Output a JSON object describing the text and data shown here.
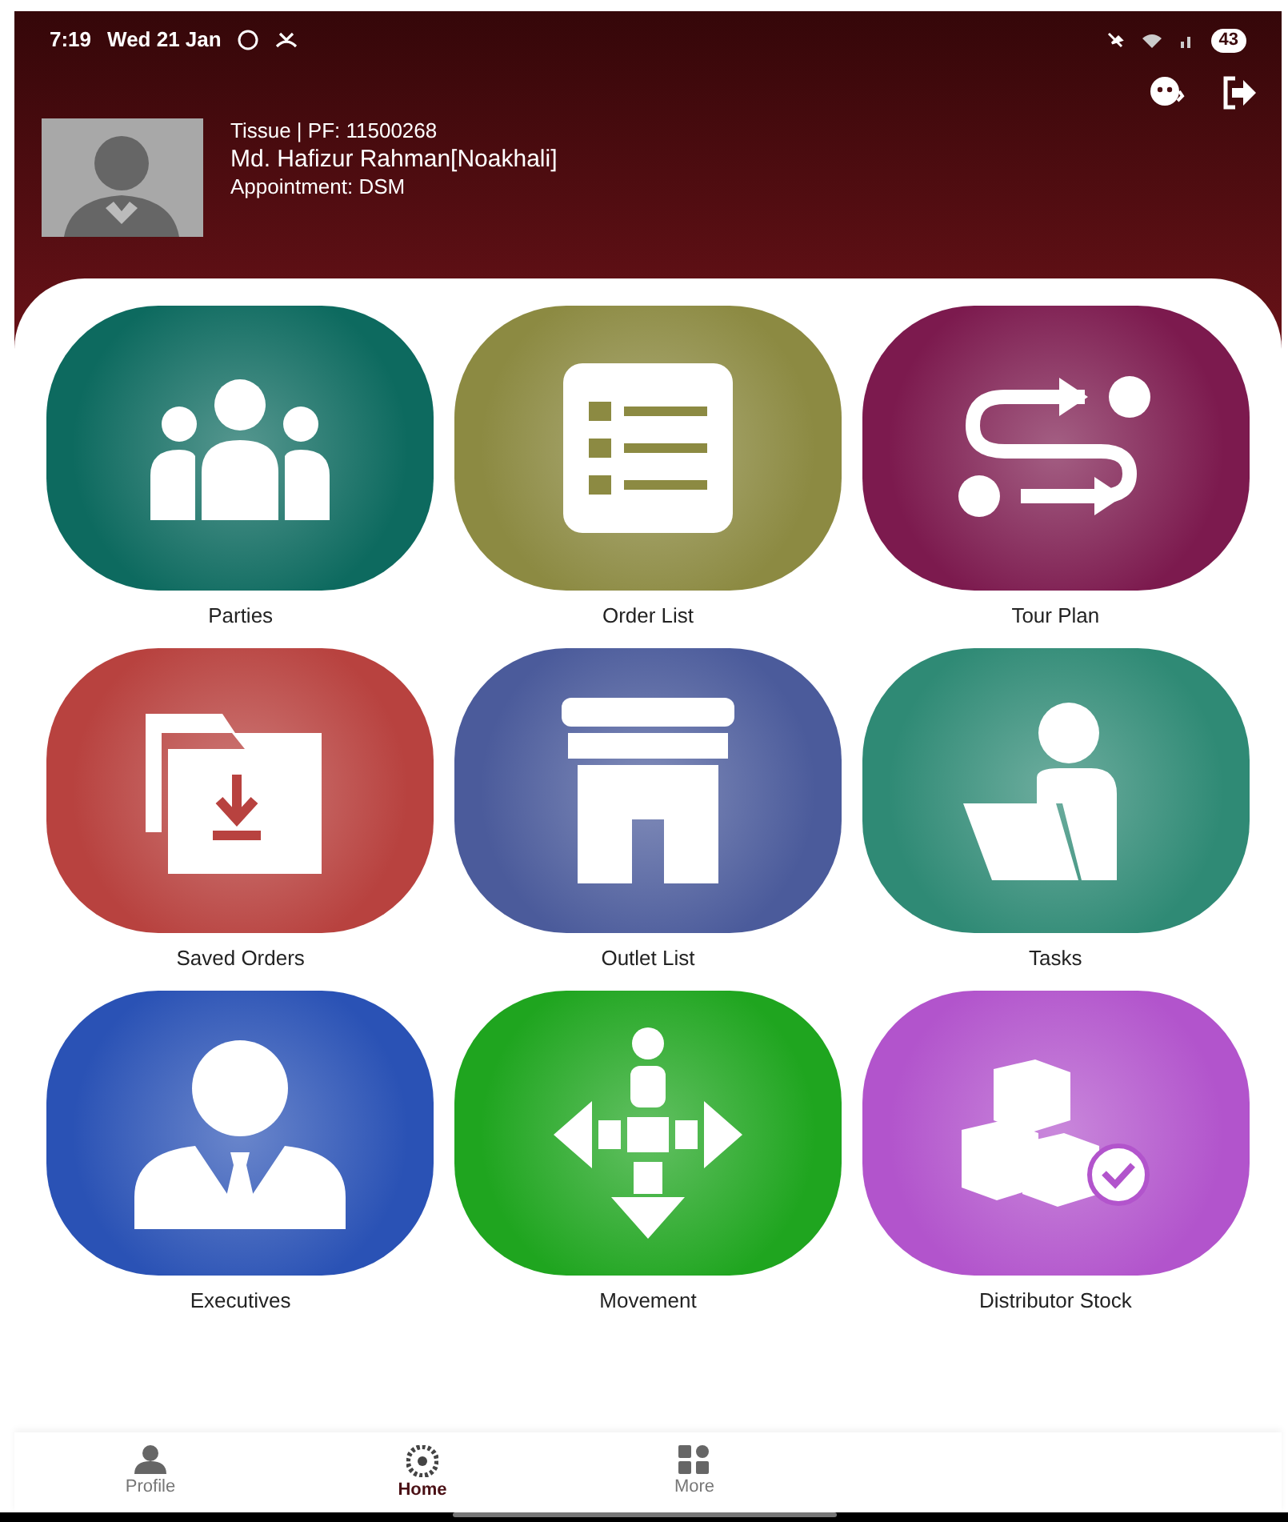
{
  "status_bar": {
    "time": "7:19",
    "date": "Wed 21 Jan",
    "battery": "43"
  },
  "profile": {
    "line_1": "Tissue | PF: 11500268",
    "name": "Md. Hafizur Rahman[Noakhali]",
    "appointment": "Appointment: DSM"
  },
  "tiles": [
    {
      "label": "Parties",
      "color": "#0d6a5f"
    },
    {
      "label": "Order List",
      "color": "#8c8a42"
    },
    {
      "label": "Tour Plan",
      "color": "#7c1a4e"
    },
    {
      "label": "Saved Orders",
      "color": "#b8423f"
    },
    {
      "label": "Outlet List",
      "color": "#4b5b9b"
    },
    {
      "label": "Tasks",
      "color": "#2f8a75"
    },
    {
      "label": "Executives",
      "color": "#2a52b5"
    },
    {
      "label": "Movement",
      "color": "#1fa51f"
    },
    {
      "label": "Distributor Stock",
      "color": "#b254cc"
    }
  ],
  "bottom_nav": [
    {
      "label": "Profile",
      "selected": false
    },
    {
      "label": "Home",
      "selected": true
    },
    {
      "label": "More",
      "selected": false
    }
  ]
}
